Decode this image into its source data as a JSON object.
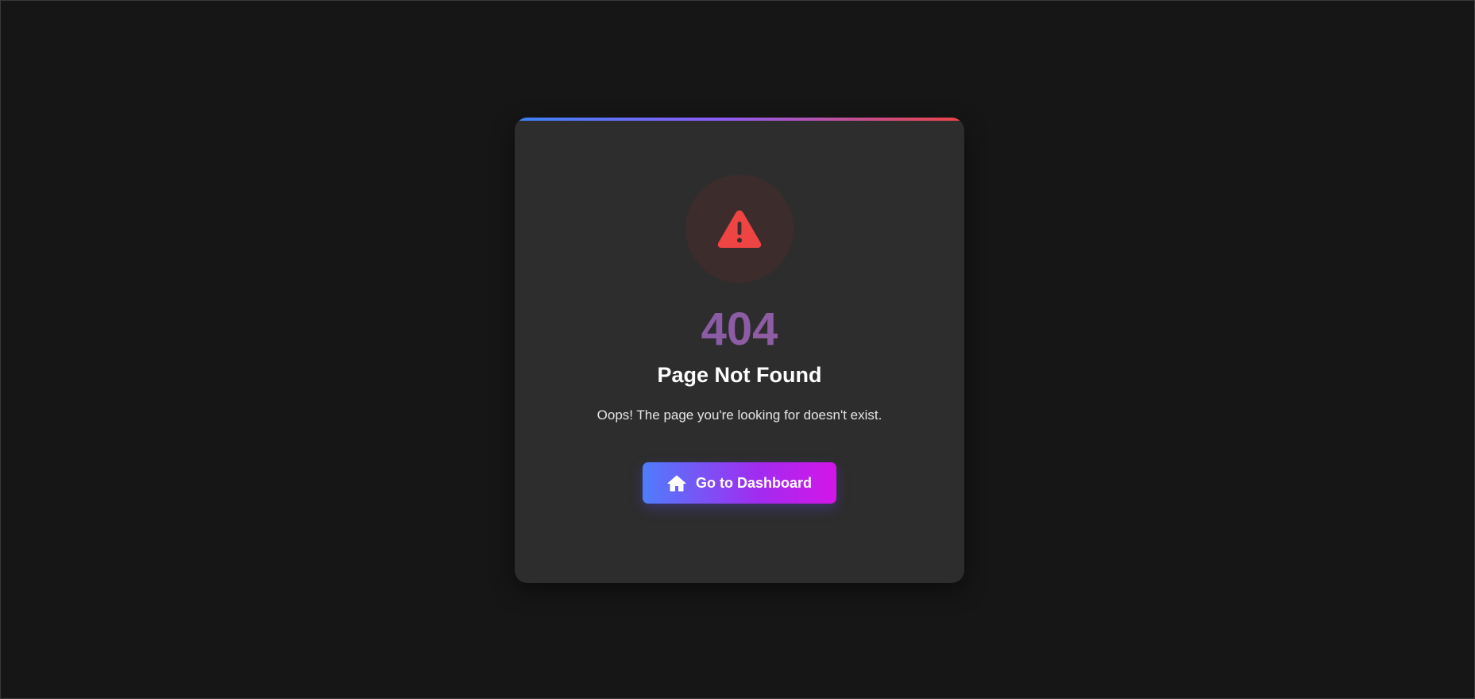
{
  "error": {
    "code": "404",
    "title": "Page Not Found",
    "message": "Oops! The page you're looking for doesn't exist."
  },
  "actions": {
    "dashboard_label": "Go to Dashboard"
  },
  "icons": {
    "status": "warning-triangle-icon",
    "button": "home-icon"
  },
  "colors": {
    "background": "#161616",
    "card": "#2d2d2d",
    "warning": "#ef4444",
    "accent_start": "#3b82f6",
    "accent_end": "#ef4444",
    "button_start": "#4f7dfc",
    "button_end": "#d415e8"
  }
}
